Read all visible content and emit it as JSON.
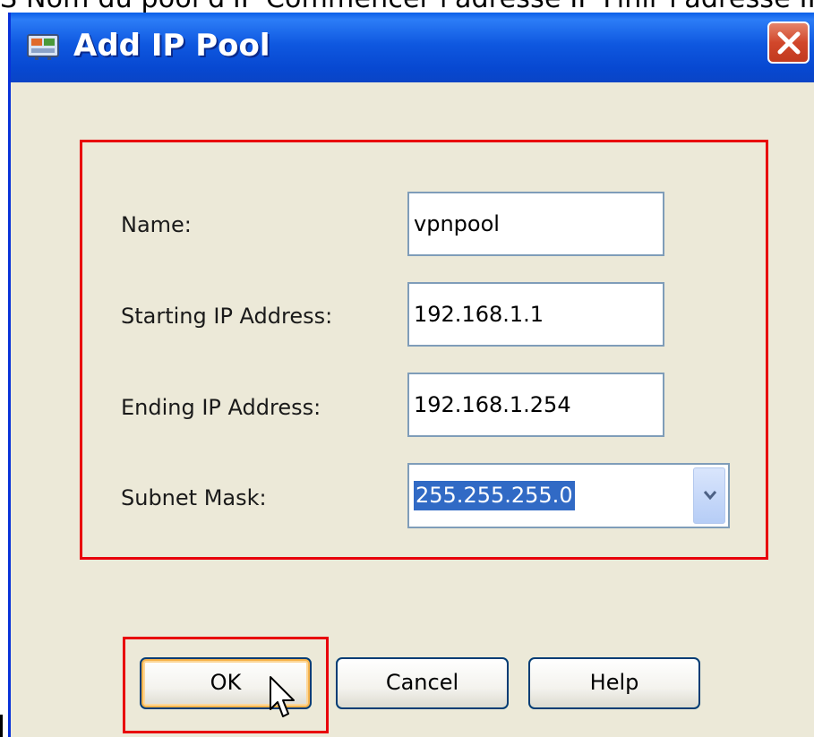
{
  "caption": "S Nom du pool d'IP Commencer l'adresse IP Finir l'adresse IP M",
  "dialog": {
    "title": "Add IP Pool",
    "title_icon": "network-card-icon",
    "close_icon": "close-x-icon"
  },
  "fields": {
    "name_label": "Name:",
    "name_value": "vpnpool",
    "start_label": "Starting IP Address:",
    "start_value": "192.168.1.1",
    "end_label": "Ending IP Address:",
    "end_value": "192.168.1.254",
    "mask_label": "Subnet Mask:",
    "mask_value": "255.255.255.0",
    "mask_dropdown_icon": "chevron-down-icon"
  },
  "buttons": {
    "ok": "OK",
    "cancel": "Cancel",
    "help": "Help"
  },
  "colors": {
    "titlebar": "#0a58e0",
    "dialog_bg": "#ece9d8",
    "highlight_box": "#e8000b",
    "selection": "#316ac5"
  }
}
